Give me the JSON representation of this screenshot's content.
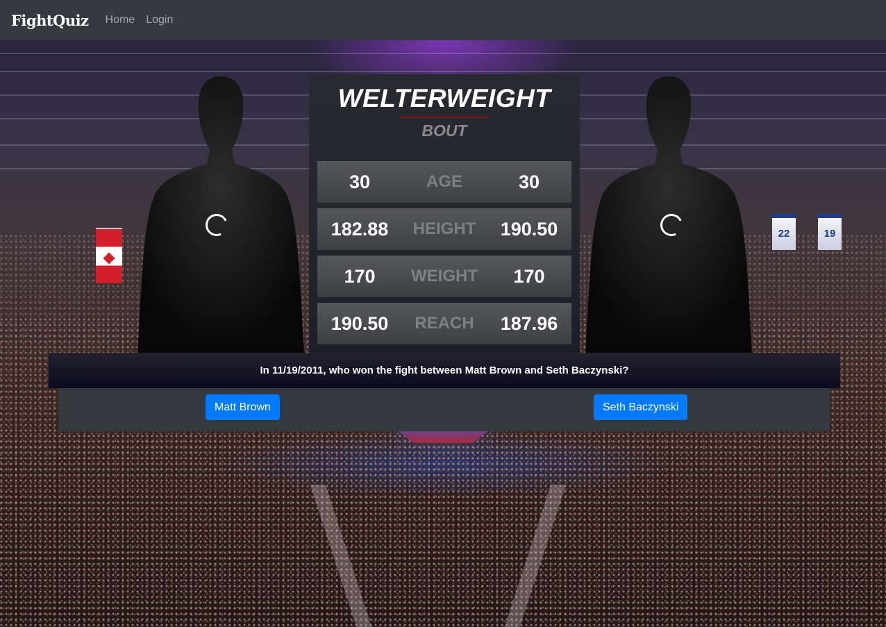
{
  "nav": {
    "brand": "FightQuiz",
    "links": [
      "Home",
      "Login"
    ]
  },
  "bout": {
    "weight_class": "WELTERWEIGHT",
    "label": "BOUT"
  },
  "stats": [
    {
      "label": "AGE",
      "left": "30",
      "right": "30"
    },
    {
      "label": "HEIGHT",
      "left": "182.88",
      "right": "190.50"
    },
    {
      "label": "WEIGHT",
      "left": "170",
      "right": "170"
    },
    {
      "label": "REACH",
      "left": "190.50",
      "right": "187.96"
    }
  ],
  "question": "In 11/19/2011, who won the fight between Matt Brown and Seth Baczynski?",
  "answers": [
    "Matt Brown",
    "Seth Baczynski"
  ],
  "background": {
    "banners": [
      "22",
      "19"
    ]
  },
  "colors": {
    "navbar": "#343a40",
    "button": "#007bff",
    "accent_underline": "#8a1414"
  }
}
